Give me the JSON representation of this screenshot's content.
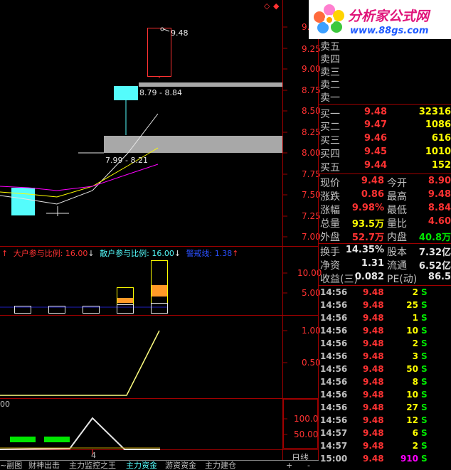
{
  "colors": {
    "up": "#ff3232",
    "down": "#54fcfc",
    "green": "#00e600",
    "yellow": "#ffff00",
    "panel_border": "#a00000"
  },
  "logo": {
    "title": "分析家公式网",
    "url": "www.88gs.com"
  },
  "price_chart": {
    "y_ticks": [
      "9.4",
      "9.25",
      "9.00",
      "8.75",
      "8.50",
      "8.25",
      "8.00",
      "7.75",
      "7.50",
      "7.25",
      "7.00"
    ],
    "annotations": {
      "high": "9.48",
      "range_upper": "8.79 - 8.84",
      "range_lower": "7.99 - 8.21"
    }
  },
  "indicator1": {
    "big_label": "大户参与比例: 16.00",
    "retail_label": "散户参与比例: 16.00",
    "warn_label": "警戒线: 1.38",
    "y_ticks": [
      "10.00",
      "5.00"
    ]
  },
  "indicator2": {
    "y_ticks": [
      "1.00",
      "0.50"
    ]
  },
  "indicator3": {
    "left_label": "00",
    "y_ticks": [
      "100.0",
      "50.00"
    ],
    "marker": "4"
  },
  "orderbook": {
    "sell": [
      {
        "label": "卖五"
      },
      {
        "label": "卖四"
      },
      {
        "label": "卖三"
      },
      {
        "label": "卖二"
      },
      {
        "label": "卖一"
      }
    ],
    "buy": [
      {
        "label": "买一",
        "price": "9.48",
        "vol": "32316"
      },
      {
        "label": "买二",
        "price": "9.47",
        "vol": "1086"
      },
      {
        "label": "买三",
        "price": "9.46",
        "vol": "616"
      },
      {
        "label": "买四",
        "price": "9.45",
        "vol": "1010"
      },
      {
        "label": "买五",
        "price": "9.44",
        "vol": "152"
      }
    ]
  },
  "quote": {
    "rows": [
      {
        "l1": "现价",
        "v1": "9.48",
        "l2": "今开",
        "v2": "8.90"
      },
      {
        "l1": "涨跌",
        "v1": "0.86",
        "l2": "最高",
        "v2": "9.48"
      },
      {
        "l1": "涨幅",
        "v1": "9.98%",
        "l2": "最低",
        "v2": "8.84"
      },
      {
        "l1": "总量",
        "v1": "93.5万",
        "l2": "量比",
        "v2": "4.60"
      },
      {
        "l1": "外盘",
        "v1": "52.7万",
        "l2": "内盘",
        "v2": "40.8万"
      }
    ],
    "rows2": [
      {
        "l1": "换手",
        "v1": "14.35%",
        "l2": "股本",
        "v2": "7.32亿"
      },
      {
        "l1": "净资",
        "v1": "1.31",
        "l2": "流通",
        "v2": "6.52亿"
      },
      {
        "l1": "收益(三)",
        "v1": "0.082",
        "l2": "PE(动)",
        "v2": "86.5"
      }
    ]
  },
  "ticks": [
    {
      "time": "14:56",
      "price": "9.48",
      "vol": "2",
      "side": "S"
    },
    {
      "time": "14:56",
      "price": "9.48",
      "vol": "25",
      "side": "S"
    },
    {
      "time": "14:56",
      "price": "9.48",
      "vol": "1",
      "side": "S"
    },
    {
      "time": "14:56",
      "price": "9.48",
      "vol": "10",
      "side": "S"
    },
    {
      "time": "14:56",
      "price": "9.48",
      "vol": "2",
      "side": "S"
    },
    {
      "time": "14:56",
      "price": "9.48",
      "vol": "3",
      "side": "S"
    },
    {
      "time": "14:56",
      "price": "9.48",
      "vol": "50",
      "side": "S"
    },
    {
      "time": "14:56",
      "price": "9.48",
      "vol": "8",
      "side": "S"
    },
    {
      "time": "14:56",
      "price": "9.48",
      "vol": "10",
      "side": "S"
    },
    {
      "time": "14:56",
      "price": "9.48",
      "vol": "27",
      "side": "S"
    },
    {
      "time": "14:56",
      "price": "9.48",
      "vol": "12",
      "side": "S"
    },
    {
      "time": "14:57",
      "price": "9.48",
      "vol": "6",
      "side": "S"
    },
    {
      "time": "14:57",
      "price": "9.48",
      "vol": "2",
      "side": "S"
    },
    {
      "time": "15:00",
      "price": "9.48",
      "vol": "910",
      "side": "S"
    }
  ],
  "tabs": [
    "~副图",
    "财神出击",
    "主力监控之王",
    "主力资金",
    "游资资金",
    "主力建仓"
  ],
  "period": "日线",
  "corner": {
    "plus": "+",
    "minus": "-",
    "left": "◇",
    "right": "◆"
  }
}
